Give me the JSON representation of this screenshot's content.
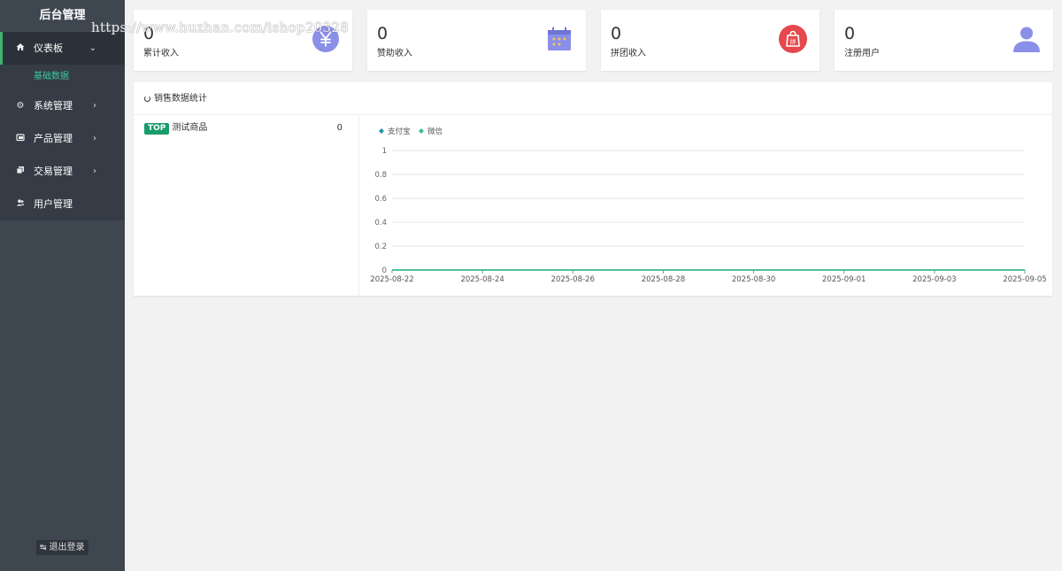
{
  "brand": "后台管理",
  "watermark": "https://www.huzhan.com/ishop20328",
  "nav": {
    "dashboard": "仪表板",
    "basic_data": "基础数据",
    "system": "系统管理",
    "product": "产品管理",
    "trade": "交易管理",
    "user": "用户管理"
  },
  "logout": "退出登录",
  "cards": [
    {
      "value": "0",
      "label": "累计收入",
      "icon": "yuan-icon",
      "color": "#8a8fe8"
    },
    {
      "value": "0",
      "label": "赞助收入",
      "icon": "calendar-icon",
      "color": "#8a8fe8"
    },
    {
      "value": "0",
      "label": "拼团收入",
      "icon": "shopping-bag-icon",
      "color": "#e5484d"
    },
    {
      "value": "0",
      "label": "注册用户",
      "icon": "user-icon",
      "color": "#8a8fe8"
    }
  ],
  "panel": {
    "title": "销售数据统计",
    "top_badge": "TOP",
    "top_item": "测试商品",
    "top_count": "0"
  },
  "chart_data": {
    "type": "line",
    "title": "",
    "xlabel": "",
    "ylabel": "",
    "x": [
      "2025-08-22",
      "2025-08-23",
      "2025-08-24",
      "2025-08-25",
      "2025-08-26",
      "2025-08-27",
      "2025-08-28",
      "2025-08-29",
      "2025-08-30",
      "2025-08-31",
      "2025-09-01",
      "2025-09-02",
      "2025-09-03",
      "2025-09-04",
      "2025-09-05"
    ],
    "x_tick_labels": [
      "2025-08-22",
      "2025-08-24",
      "2025-08-26",
      "2025-08-28",
      "2025-08-30",
      "2025-09-01",
      "2025-09-03",
      "2025-09-05"
    ],
    "y_tick_labels": [
      "0",
      "0.2",
      "0.4",
      "0.6",
      "0.8",
      "1"
    ],
    "ylim": [
      0,
      1
    ],
    "grid": true,
    "legend": "top-left",
    "series": [
      {
        "name": "支付宝",
        "color": "#2196a8",
        "values": [
          0,
          0,
          0,
          0,
          0,
          0,
          0,
          0,
          0,
          0,
          0,
          0,
          0,
          0,
          0
        ]
      },
      {
        "name": "微信",
        "color": "#3dbd8c",
        "values": [
          0,
          0,
          0,
          0,
          0,
          0,
          0,
          0,
          0,
          0,
          0,
          0,
          0,
          0,
          0
        ]
      }
    ]
  }
}
